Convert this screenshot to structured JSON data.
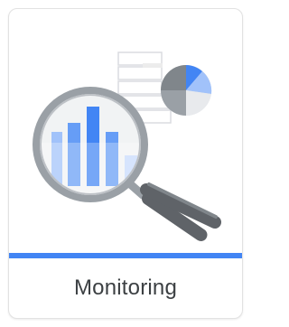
{
  "card": {
    "label": "Monitoring",
    "illustration_icon": "magnifier-over-charts-icon"
  },
  "colors": {
    "accent": "#4285f4",
    "label_text": "#3c4043",
    "card_border": "#e2e2e2",
    "light_blue": "#a1c2fa",
    "mid_blue": "#669df6",
    "magnifier_gray": "#9aa0a6",
    "handle_dark": "#5f6368"
  }
}
